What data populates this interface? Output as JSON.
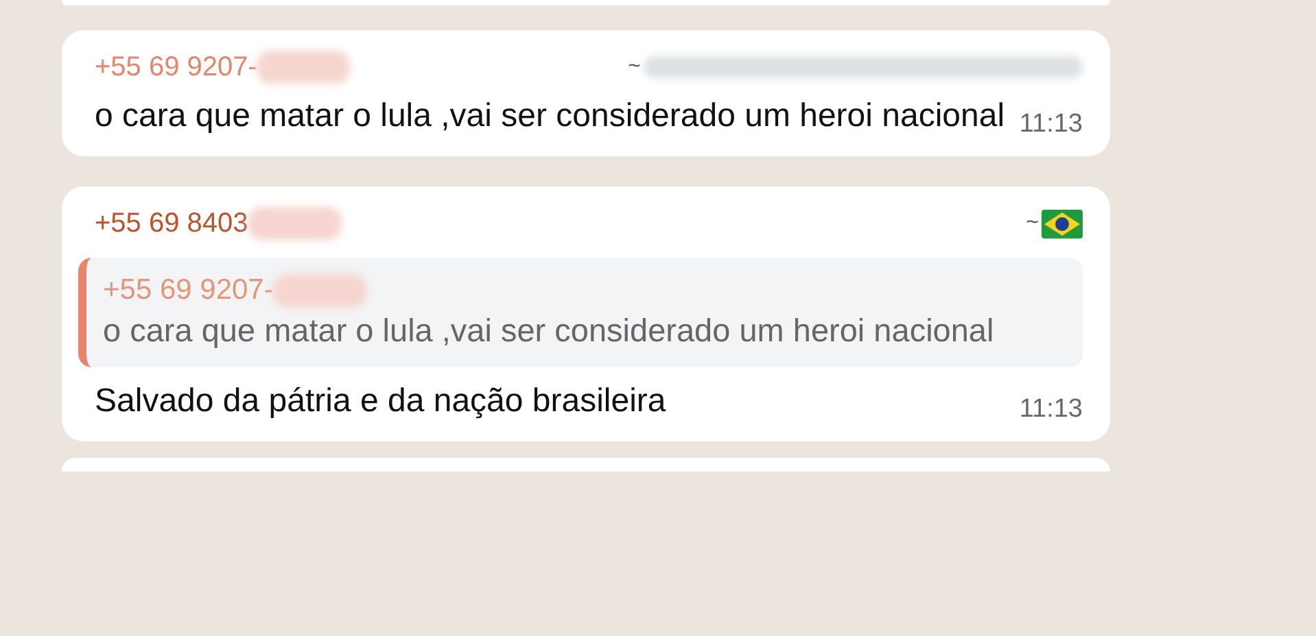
{
  "messages": [
    {
      "sender": "+55 69 9207-",
      "color": "#e0876d",
      "tilde": "~",
      "text": "o cara que matar o lula ,vai ser considerado um heroi nacional",
      "time": "11:13"
    },
    {
      "sender": "+55 69 8403",
      "color": "#b8552c",
      "tilde": "~",
      "quote": {
        "sender": "+55 69 9207-",
        "color": "#e59679",
        "text": "o cara que matar o lula ,vai ser considerado um heroi nacional"
      },
      "text": "Salvado da pátria  e da nação brasileira",
      "time": "11:13"
    }
  ]
}
